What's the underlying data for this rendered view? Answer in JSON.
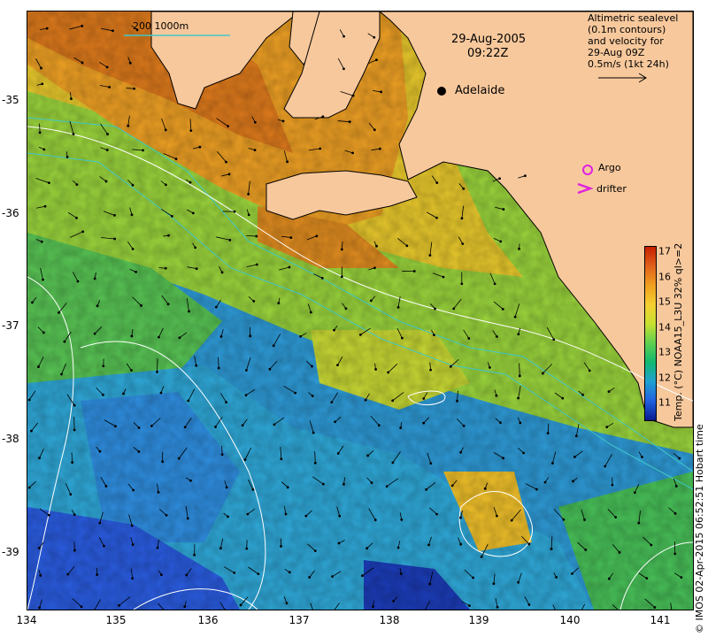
{
  "date_line": "29-Aug-2005",
  "time_line": "09:22Z",
  "city": "Adelaide",
  "depth_label": "200  1000m",
  "info_lines": [
    "Altimetric sealevel",
    "(0.1m contours)",
    "and velocity for",
    "29-Aug 09Z",
    "0.5m/s (1kt 24h)"
  ],
  "argo_label": "Argo",
  "drifter_label": "drifter",
  "x_ticks": [
    "134",
    "135",
    "136",
    "137",
    "138",
    "139",
    "140",
    "141"
  ],
  "y_ticks": [
    "-35",
    "-36",
    "-37",
    "-38",
    "-39"
  ],
  "colorbar": {
    "ticks": [
      "17",
      "16",
      "15",
      "14",
      "13",
      "12",
      "11"
    ],
    "label": "Temp. (°C) NOAA15_L3U 32% ql>=2",
    "stops": [
      "#c62000",
      "#e0601a",
      "#f0a020",
      "#f4d030",
      "#c8e030",
      "#60d050",
      "#10b870",
      "#20a0d0",
      "#2060e0",
      "#0a1a90"
    ]
  },
  "credit": "© IMOS 02-Apr-2015 06:52:51 Hobart time",
  "colors": {
    "land": "#f7c89c",
    "argo": "#e020e0",
    "drifter": "#e020e0",
    "contour": "#ffffff",
    "isobath": "#40c8c8"
  }
}
